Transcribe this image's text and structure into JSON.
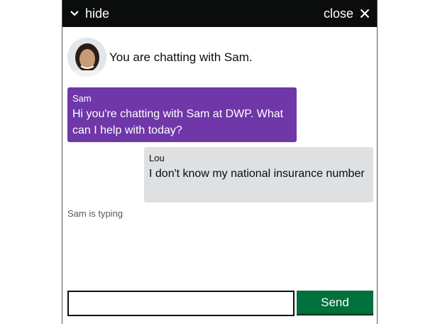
{
  "header": {
    "hide_label": "hide",
    "close_label": "close",
    "hide_icon": "chevron-down-icon",
    "close_icon": "close-icon"
  },
  "intro": {
    "avatar": "agent-avatar",
    "text": "You are chatting with Sam."
  },
  "messages": [
    {
      "sender": "Sam",
      "text": "Hi you're chatting with Sam at DWP. What can I help with today?",
      "color": "#6f37a8"
    },
    {
      "sender": "Lou",
      "text": "I don't know my national insurance number",
      "color": "#dee0e2"
    }
  ],
  "status": {
    "typing": "Sam is typing"
  },
  "composer": {
    "input_value": "",
    "send_label": "Send"
  },
  "colors": {
    "header_bg": "#0b0c0c",
    "agent_bubble": "#6f37a8",
    "user_bubble": "#dee0e2",
    "send_button": "#00703c"
  }
}
